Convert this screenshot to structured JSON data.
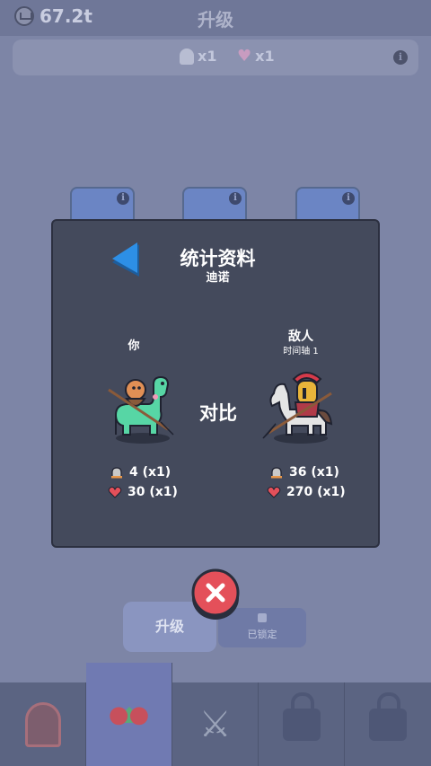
{
  "header": {
    "currency_value": "67.2t",
    "title": "升级"
  },
  "buffs": {
    "attack_multiplier": "x1",
    "health_multiplier": "x1"
  },
  "buttons": {
    "upgrade_label": "升级",
    "locked_label": "已锁定"
  },
  "modal": {
    "title": "统计资料",
    "subtitle": "迪诺",
    "you_label": "你",
    "enemy_label": "敌人",
    "enemy_sub": "时间轴 1",
    "vs_label": "对比",
    "you_stats": {
      "attack": "4 (x1)",
      "health": "30 (x1)"
    },
    "enemy_stats": {
      "attack": "36 (x1)",
      "health": "270 (x1)"
    }
  },
  "colors": {
    "modal_bg": "#444a5c",
    "back_arrow": "#2d8fe6",
    "close_red": "#e4505a",
    "dino_green": "#57d6a5"
  },
  "icons": {
    "back": "triangle-left-icon",
    "close": "x-icon",
    "attack": "bell-attack-icon",
    "health": "heart-icon"
  }
}
